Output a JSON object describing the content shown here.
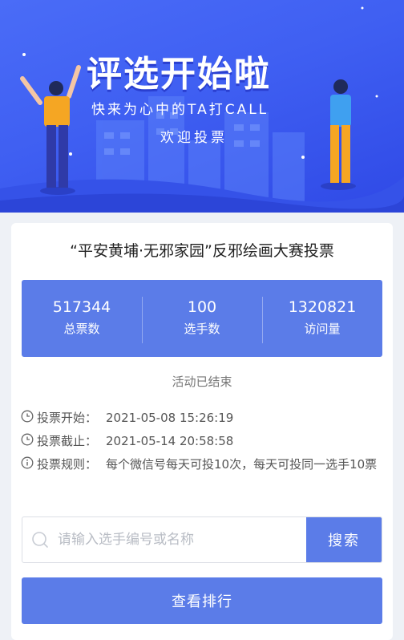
{
  "banner": {
    "title": "评选开始啦",
    "subtitle": "快来为心中的TA打CALL",
    "tagline": "欢迎投票"
  },
  "event": {
    "title": "“平安黄埔·无邪家园”反邪绘画大赛投票",
    "status": "活动已结束"
  },
  "stats": [
    {
      "value": "517344",
      "label": "总票数"
    },
    {
      "value": "100",
      "label": "选手数"
    },
    {
      "value": "1320821",
      "label": "访问量"
    }
  ],
  "info": {
    "start_label": "投票开始：",
    "start_value": "2021-05-08 15:26:19",
    "end_label": "投票截止：",
    "end_value": "2021-05-14 20:58:58",
    "rules_label": "投票规则：",
    "rules_value": "每个微信号每天可投10次，每天可投同一选手10票"
  },
  "search": {
    "placeholder": "请输入选手编号或名称",
    "button_label": "搜索"
  },
  "ranking_button": "查看排行",
  "colors": {
    "accent": "#5b7ce8",
    "banner": "#3f5ff2"
  }
}
